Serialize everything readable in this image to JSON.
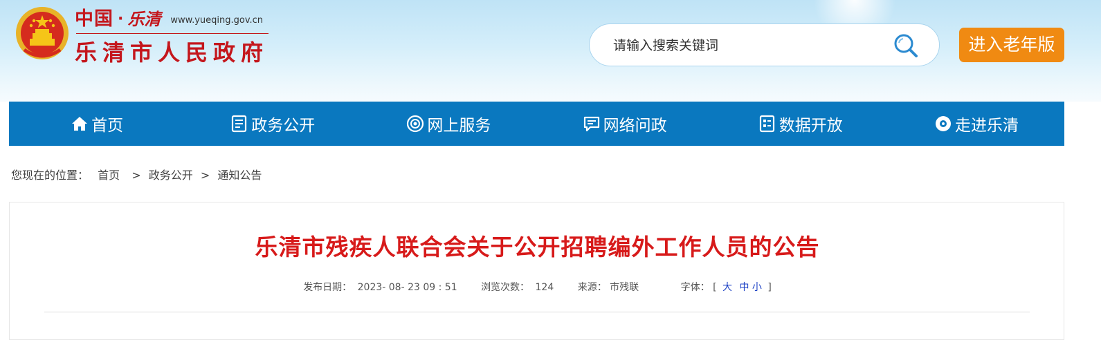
{
  "header": {
    "logo_cn": "中国",
    "logo_dot": "·",
    "logo_sig": "乐清",
    "logo_url": "www.yueqing.gov.cn",
    "logo_main": "乐清市人民政府"
  },
  "search": {
    "placeholder": "请输入搜索关键词"
  },
  "elder_button": "进入老年版",
  "nav": {
    "items": [
      {
        "label": "首页",
        "icon": "home-icon"
      },
      {
        "label": "政务公开",
        "icon": "document-icon"
      },
      {
        "label": "网上服务",
        "icon": "service-icon"
      },
      {
        "label": "网络问政",
        "icon": "chat-icon"
      },
      {
        "label": "数据开放",
        "icon": "data-icon"
      },
      {
        "label": "走进乐清",
        "icon": "eye-icon"
      }
    ]
  },
  "breadcrumb": {
    "prefix": "您现在的位置：",
    "items": [
      "首页",
      "政务公开",
      "通知公告"
    ],
    "separator": ">"
  },
  "article": {
    "title": "乐清市残疾人联合会关于公开招聘编外工作人员的公告",
    "date_label": "发布日期：",
    "date_value": "2023- 08- 23 09 : 51",
    "views_label": "浏览次数：",
    "views_value": "124",
    "source_label": "来源：",
    "source_value": "市残联",
    "font_label": "字体：",
    "font_open": "[",
    "font_large": "大",
    "font_medium": "中",
    "font_small": "小",
    "font_close": "]"
  },
  "colors": {
    "nav_bg": "#0a78bf",
    "title_red": "#d71a1a",
    "elder_orange": "#f08a12",
    "logo_red": "#c4161c"
  }
}
